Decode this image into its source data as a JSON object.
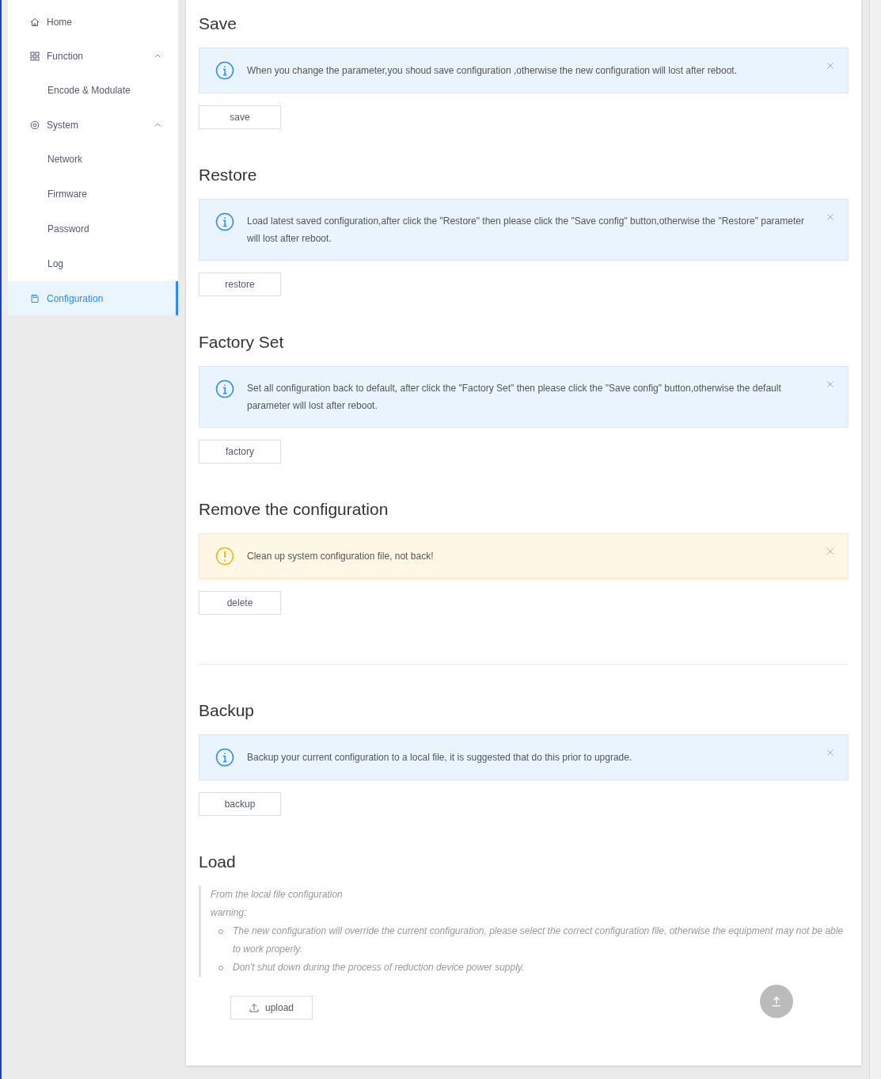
{
  "sidebar": {
    "items": [
      {
        "label": "Home",
        "selected": false
      },
      {
        "label": "Function",
        "expanded": true,
        "selected": false,
        "children": [
          {
            "label": "Encode & Modulate",
            "selected": false
          }
        ]
      },
      {
        "label": "System",
        "expanded": true,
        "selected": false,
        "children": [
          {
            "label": "Network",
            "selected": false
          },
          {
            "label": "Firmware",
            "selected": false
          },
          {
            "label": "Password",
            "selected": false
          },
          {
            "label": "Log",
            "selected": false
          }
        ]
      },
      {
        "label": "Configuration",
        "selected": true
      }
    ]
  },
  "sections": [
    {
      "title": "Save",
      "alert": {
        "kind": "info",
        "text": "When you change the parameter,you shoud save configuration ,otherwise the new configuration will lost after reboot."
      },
      "button": "save"
    },
    {
      "title": "Restore",
      "alert": {
        "kind": "info",
        "text": "Load latest saved configuration,after click the \"Restore\" then please click the \"Save config\" button,otherwise the \"Restore\" parameter will lost after reboot."
      },
      "button": "restore"
    },
    {
      "title": "Factory Set",
      "alert": {
        "kind": "info",
        "text": "Set all configuration back to default, after click the \"Factory Set\" then please click the \"Save config\" button,otherwise the default parameter will lost after reboot."
      },
      "button": "factory"
    },
    {
      "title": "Remove the configuration",
      "alert": {
        "kind": "warning",
        "text": "Clean up system configuration file, not back!"
      },
      "button": "delete"
    },
    {
      "title": "Backup",
      "alert": {
        "kind": "info",
        "text": "Backup your current configuration to a local file, it is suggested that do this prior to upgrade."
      },
      "button": "backup"
    }
  ],
  "load": {
    "title": "Load",
    "note": "From the local file configuration",
    "warning_label": "warning:",
    "warnings": [
      "The new configuration will override the current configuration, please select the correct configuration file, otherwise the equipment may not be able to work properly.",
      "Don't shut down during the process of reduction device power supply."
    ],
    "button": "upload"
  }
}
